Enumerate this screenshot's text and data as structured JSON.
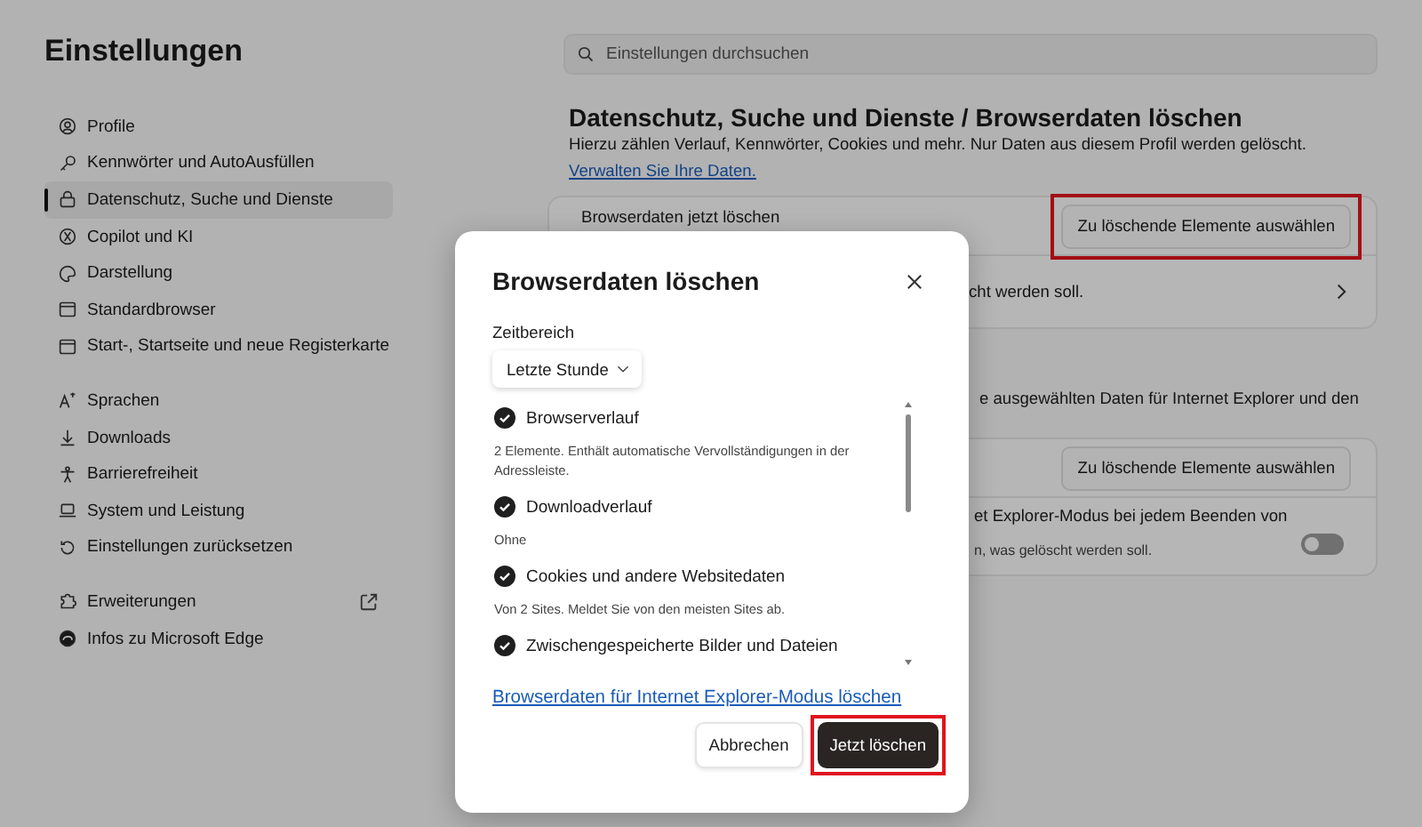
{
  "sidebar": {
    "title": "Einstellungen",
    "groups": [
      [
        {
          "label": "Profile",
          "selected": false
        },
        {
          "label": "Kennwörter und AutoAusfüllen",
          "selected": false
        },
        {
          "label": "Datenschutz, Suche und Dienste",
          "selected": true
        },
        {
          "label": "Copilot und KI",
          "selected": false
        },
        {
          "label": "Darstellung",
          "selected": false
        },
        {
          "label": "Standardbrowser",
          "selected": false
        },
        {
          "label": "Start-, Startseite und neue Registerkarte",
          "selected": false
        }
      ],
      [
        {
          "label": "Sprachen",
          "selected": false
        },
        {
          "label": "Downloads",
          "selected": false
        },
        {
          "label": "Barrierefreiheit",
          "selected": false
        },
        {
          "label": "System und Leistung",
          "selected": false
        },
        {
          "label": "Einstellungen zurücksetzen",
          "selected": false
        }
      ],
      [
        {
          "label": "Erweiterungen",
          "selected": false,
          "external": true
        },
        {
          "label": "Infos zu Microsoft Edge",
          "selected": false
        }
      ]
    ]
  },
  "search": {
    "placeholder": "Einstellungen durchsuchen"
  },
  "page": {
    "heading": "Datenschutz, Suche und Dienste / Browserdaten löschen",
    "description": "Hierzu zählen Verlauf, Kennwörter, Cookies und mehr. Nur Daten aus diesem Profil werden gelöscht.",
    "link": "Verwalten Sie Ihre Daten."
  },
  "card_1": {
    "label": "Browserdaten jetzt löschen",
    "button": {
      "label": "Zu löschende Elemente auswählen",
      "highlighted": true
    },
    "row_2_text": "cht werden soll."
  },
  "section_2_text": "e ausgewählten Daten für Internet Explorer und den",
  "card_2": {
    "button": {
      "label": "Zu löschende Elemente auswählen",
      "highlighted": false
    },
    "row_2_title": "et Explorer-Modus bei jedem Beenden von",
    "row_2_text": "n, was gelöscht werden soll.",
    "toggle_on": false
  },
  "dialog": {
    "title": "Browserdaten löschen",
    "time_range_label": "Zeitbereich",
    "time_range": "Letzte Stunde",
    "items": [
      {
        "label": "Browserverlauf",
        "checked": true,
        "description": "2 Elemente. Enthält automatische Vervollständigungen in der Adressleiste."
      },
      {
        "label": "Downloadverlauf",
        "checked": true,
        "description": "Ohne"
      },
      {
        "label": "Cookies und andere Websitedaten",
        "checked": true,
        "description": "Von 2 Sites. Meldet Sie von den meisten Sites ab."
      },
      {
        "label": "Zwischengespeicherte Bilder und Dateien",
        "checked": true
      }
    ],
    "link": "Browserdaten für Internet Explorer-Modus löschen",
    "buttons": [
      {
        "kind": "secondary",
        "label": "Abbrechen",
        "highlighted": false
      },
      {
        "kind": "primary",
        "label": "Jetzt löschen",
        "highlighted": true
      }
    ]
  }
}
